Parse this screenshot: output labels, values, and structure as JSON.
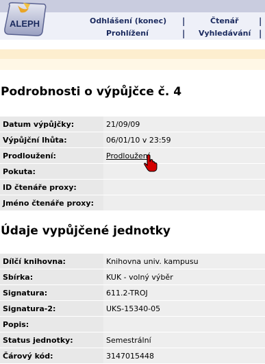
{
  "header": {
    "logo_text": "ALEPH",
    "nav_top": [
      {
        "label": "Odhlášení (konec)"
      },
      {
        "label": "Čtenář"
      }
    ],
    "nav_bottom": [
      {
        "label": "Prohlížení"
      },
      {
        "label": "Vyhledávání"
      }
    ],
    "separator": "|"
  },
  "loan": {
    "title": "Podrobnosti o výpůjčce č. 4",
    "rows": [
      {
        "label": "Datum výpůjčky:",
        "value": "21/09/09"
      },
      {
        "label": "Výpůjční lhůta:",
        "value": "06/01/10 v 23:59"
      },
      {
        "label": "Prodloužení:",
        "value": "Prodloužení"
      },
      {
        "label": "Pokuta:",
        "value": ""
      },
      {
        "label": "ID čtenáře proxy:",
        "value": ""
      },
      {
        "label": "Jméno čtenáře proxy:",
        "value": ""
      }
    ]
  },
  "item": {
    "title": "Údaje vypůjčené jednotky",
    "rows": [
      {
        "label": "Dílčí knihovna:",
        "value": "Knihovna univ. kampusu"
      },
      {
        "label": "Sbírka:",
        "value": "KUK - volný výběr"
      },
      {
        "label": "Signatura:",
        "value": "611.2-TROJ"
      },
      {
        "label": "Signatura-2:",
        "value": "UKS-15340-05"
      },
      {
        "label": "Popis:",
        "value": ""
      },
      {
        "label": "Status jednotky:",
        "value": "Semestrální"
      },
      {
        "label": "Čárový kód:",
        "value": "3147015448"
      }
    ]
  },
  "colors": {
    "nav_text": "#1b2a5e",
    "label_bg": "#e8e8e8",
    "value_bg": "#eeeeee",
    "top_band": "#c9ccdf"
  }
}
